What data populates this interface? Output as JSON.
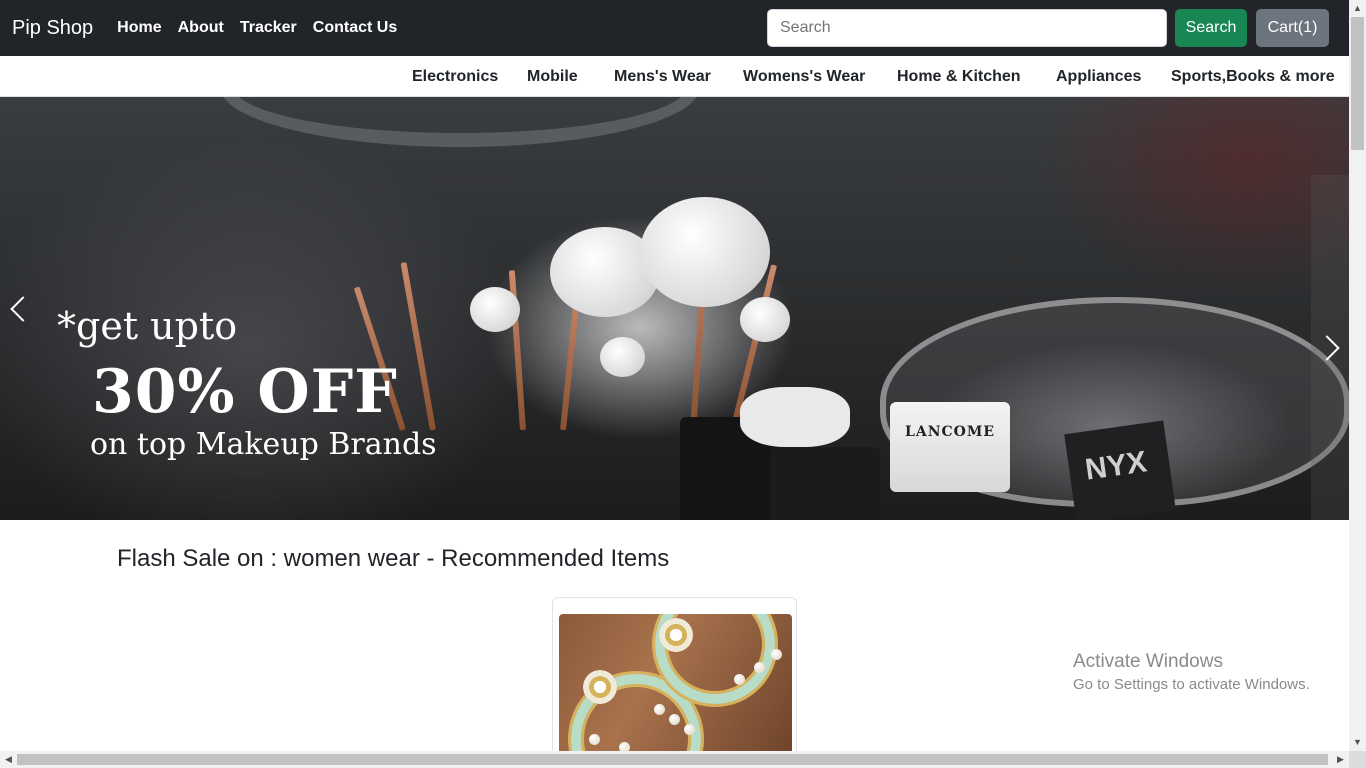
{
  "navbar": {
    "brand": "Pip Shop",
    "links": [
      "Home",
      "About",
      "Tracker",
      "Contact Us"
    ],
    "search_placeholder": "Search",
    "search_button": "Search",
    "cart_button": "Cart(1)"
  },
  "categories": [
    "Electronics",
    "Mobile",
    "Mens's Wear",
    "Womens's Wear",
    "Home & Kitchen",
    "Appliances",
    "Sports,Books & more"
  ],
  "carousel": {
    "line1": "*get upto",
    "line2": "30% OFF",
    "line3": "on top Makeup Brands",
    "brand_labels": [
      "LANCOME",
      "NYX"
    ]
  },
  "section": {
    "title": "Flash Sale on : women wear - Recommended Items"
  },
  "watermark": {
    "line1": "Activate Windows",
    "line2": "Go to Settings to activate Windows."
  },
  "colors": {
    "navbar_bg": "#212529",
    "search_button": "#198754",
    "cart_button": "#6c757d"
  },
  "icons": {
    "carousel_prev": "chevron-left-icon",
    "carousel_next": "chevron-right-icon"
  }
}
